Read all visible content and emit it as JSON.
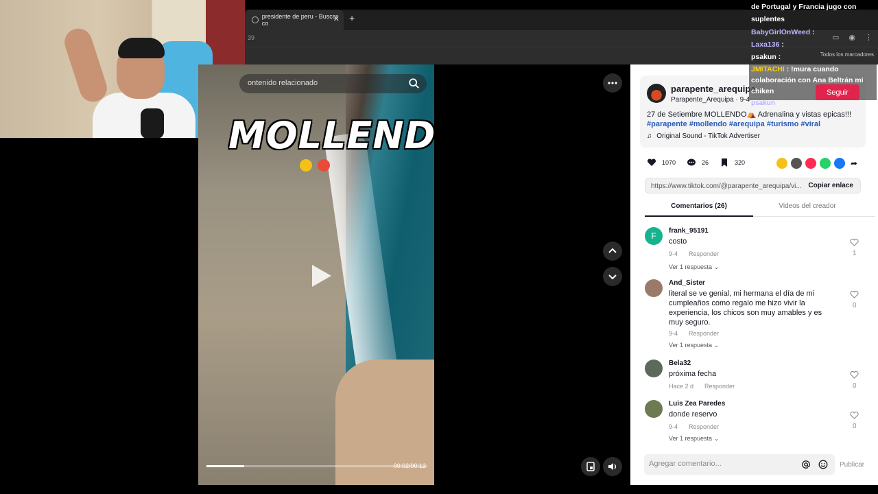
{
  "browser": {
    "tab_title": "presidente de peru - Buscar co",
    "new_tab": "+",
    "url_fragment": "39",
    "bookmarks_label": "Todos los marcadores"
  },
  "video": {
    "search_placeholder": "ontenido relacionado",
    "caption": "MOLLENDO",
    "time": "00:02/00:12",
    "progress": 0.17
  },
  "panel": {
    "username": "parapente_arequipa",
    "subline": "Parapente_Arequipa · 9-4",
    "description": "27 de Setiembre MOLLENDO",
    "description_tail": " Adrenalina y vistas epicas!!!",
    "hashtags": "#parapente #mollendo #arequipa #turismo #viral",
    "music": "Original Sound - TikTok Advertiser",
    "likes": "1070",
    "comments_count": "26",
    "saves": "320",
    "link_url": "https://www.tiktok.com/@parapente_arequipa/vi...",
    "copy_link": "Copiar enlace",
    "tab_comments": "Comentarios (26)",
    "tab_videos": "Videos del creador",
    "follow": "Seguir",
    "composer_placeholder": "Agregar comentario...",
    "publish": "Publicar"
  },
  "comments": [
    {
      "name": "frank_95191",
      "avatar_letter": "F",
      "text": "costo",
      "date": "9-4",
      "reply": "Responder",
      "likes": "1",
      "more": "Ver 1 respuesta"
    },
    {
      "name": "And_Sister",
      "text": "literal se ve genial, mi hermana el día de mi cumpleaños como regalo me hizo vivir la experiencia, los chicos son muy amables y es muy seguro.",
      "date": "9-4",
      "reply": "Responder",
      "likes": "0",
      "more": "Ver 1 respuesta"
    },
    {
      "name": "Bela32",
      "text": "próxima fecha",
      "date": "Hace 2 d",
      "reply": "Responder",
      "likes": "0"
    },
    {
      "name": "Luis Zea Paredes",
      "text": "donde reservo",
      "date": "9-4",
      "reply": "Responder",
      "likes": "0",
      "more": "Ver 1 respuesta"
    }
  ],
  "chat": [
    {
      "user": "",
      "message": "de Portugal y Francia jugo con"
    },
    {
      "user": "",
      "message": "suplentes"
    },
    {
      "user": "BabyGirlOnWeed",
      "message": ":"
    },
    {
      "user": "Laxa136",
      "message": ":"
    },
    {
      "user": "psakun",
      "message": ":"
    },
    {
      "user": "JMITACHI",
      "message": ": !mura cuando colaboración con Ana Beltrán mi chiken"
    },
    {
      "user": "psakun",
      "message": ":"
    }
  ],
  "colors": {
    "follow": "#e0244b",
    "hashtag": "#2b5db9",
    "chat_user": "#b9b3ff",
    "chat_user_highlight": "#ffd200"
  }
}
